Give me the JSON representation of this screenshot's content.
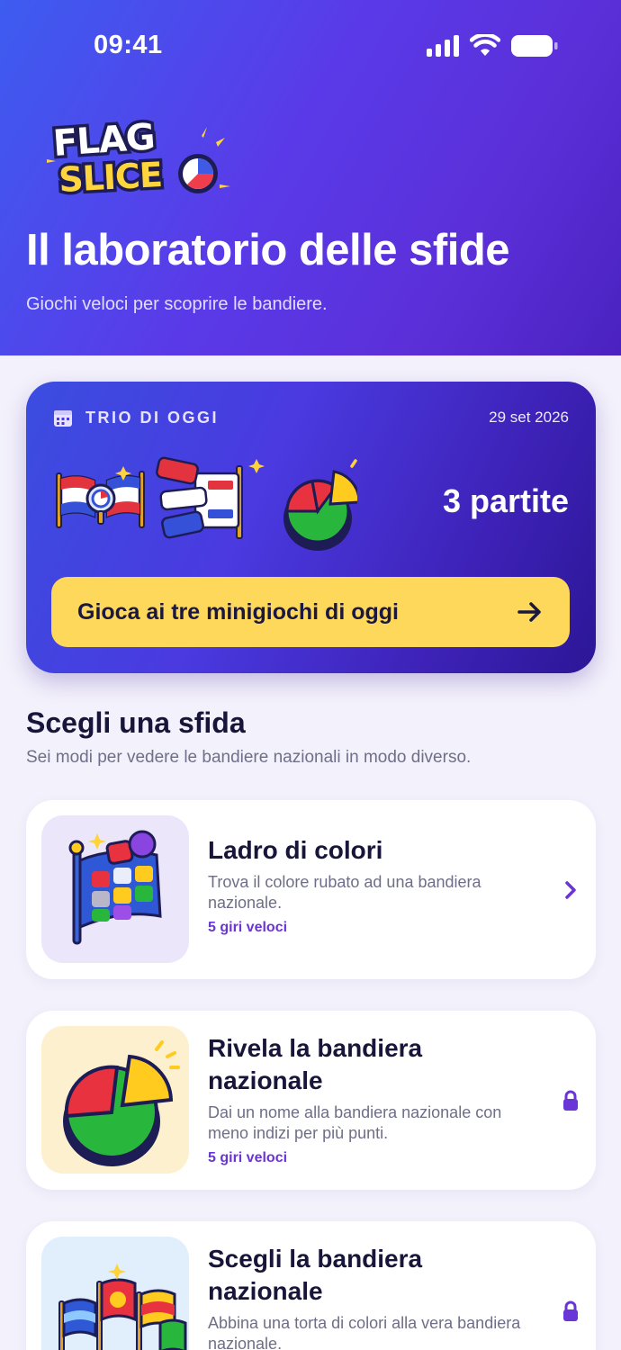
{
  "status_bar": {
    "time": "09:41"
  },
  "hero": {
    "logo_text_top": "FLAG",
    "logo_text_bottom": "SLICE",
    "title": "Il laboratorio delle sfide",
    "subtitle": "Giochi veloci per scoprire le bandiere."
  },
  "daily": {
    "label": "TRIO DI OGGI",
    "date": "29 set 2026",
    "count": "3 partite",
    "cta_label": "Gioca ai tre minigiochi di oggi",
    "icons": [
      "flag-magnifier-icon",
      "flag-stripes-icon",
      "pie-slice-icon"
    ]
  },
  "section": {
    "title": "Scegli una sfida",
    "subtitle": "Sei modi per vedere le bandiere nazionali in modo diverso."
  },
  "games": [
    {
      "title": "Ladro di colori",
      "description": "Trova il colore rubato ad una bandiera nazionale.",
      "meta": "5 giri veloci",
      "icon": "color-flag-icon",
      "trailing": "chevron-right-icon",
      "thumb_bg": "#ece6fb"
    },
    {
      "title": "Rivela la bandiera nazionale",
      "description": "Dai un nome alla bandiera nazionale con meno indizi per più punti.",
      "meta": "5 giri veloci",
      "icon": "pie-chart-icon",
      "trailing": "lock-icon",
      "thumb_bg": "#fdf0cf"
    },
    {
      "title": "Scegli la bandiera nazionale",
      "description": "Abbina una torta di colori alla vera bandiera nazionale.",
      "meta": "",
      "icon": "flags-row-icon",
      "trailing": "lock-icon",
      "thumb_bg": "#e1eefc"
    }
  ],
  "colors": {
    "accent": "#6a35d6",
    "cta": "#fdd85b",
    "background": "#f3f1fb",
    "title": "#17163a"
  }
}
